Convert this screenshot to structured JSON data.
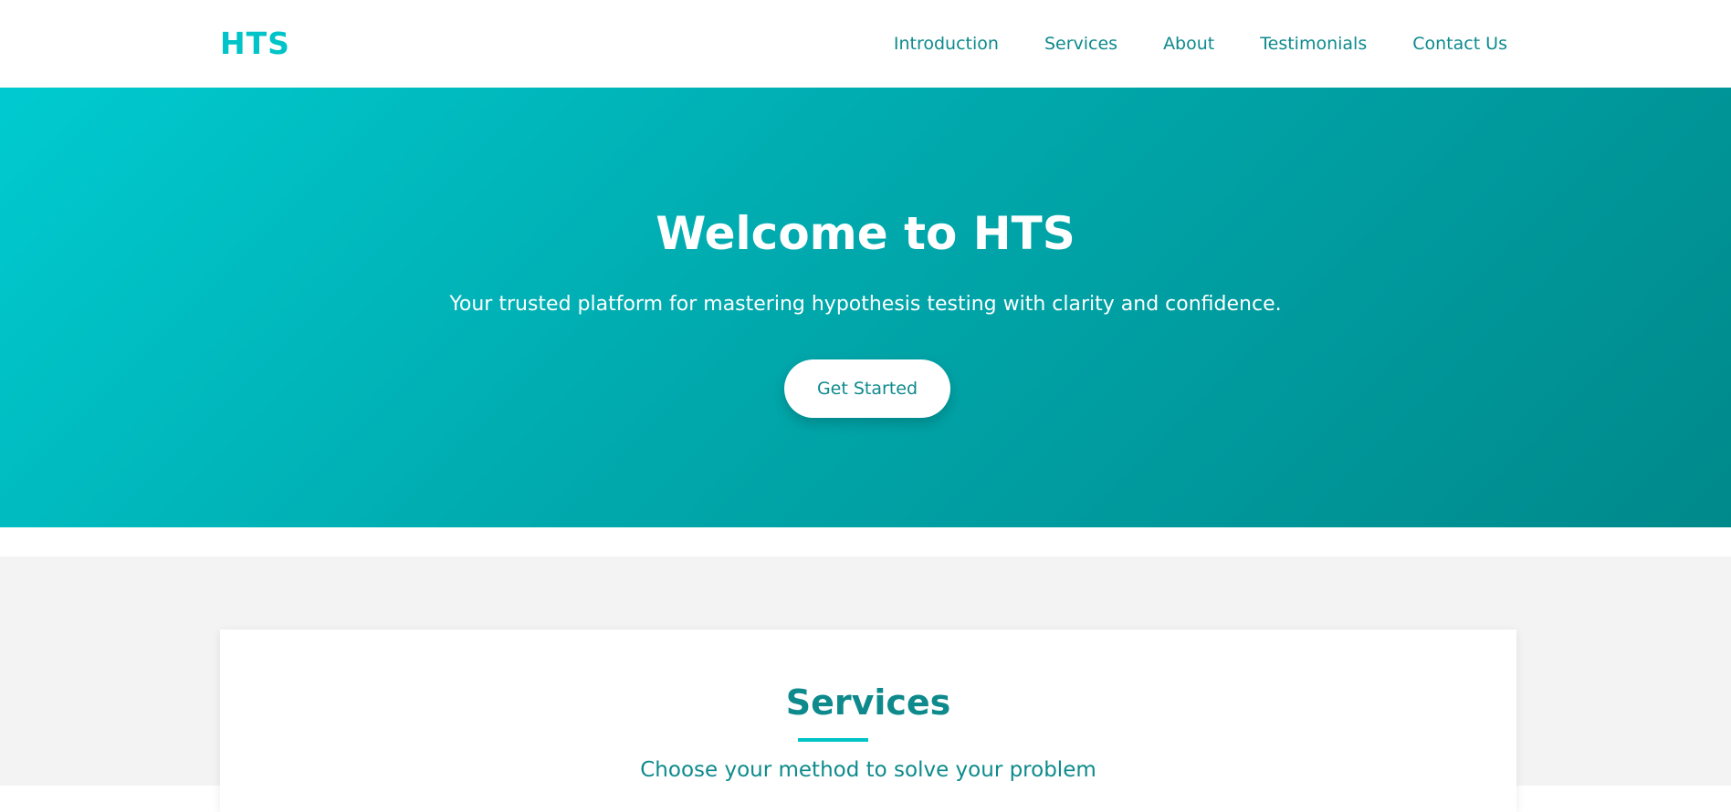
{
  "navbar": {
    "logo": "HTS",
    "links": [
      "Introduction",
      "Services",
      "About",
      "Testimonials",
      "Contact Us"
    ]
  },
  "hero": {
    "title": "Welcome to HTS",
    "subtitle": "Your trusted platform for mastering hypothesis testing with clarity and confidence.",
    "cta_label": "Get Started"
  },
  "services": {
    "title": "Services",
    "subtitle": "Choose your method to solve your problem"
  },
  "colors": {
    "brand": "#00c4c8",
    "text_teal": "#0e8a8c",
    "hero_gradient_start": "#00cbd0",
    "hero_gradient_end": "#00898b",
    "section_bg": "#f3f3f3"
  }
}
